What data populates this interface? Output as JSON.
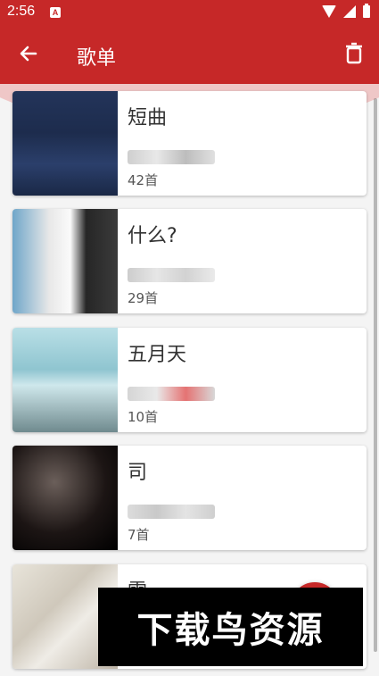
{
  "status_bar": {
    "time": "2:56"
  },
  "app_bar": {
    "title": "歌单"
  },
  "playlists": [
    {
      "name": "短曲",
      "count": "42首"
    },
    {
      "name": "什么?",
      "count": "29首"
    },
    {
      "name": "五月天",
      "count": "10首"
    },
    {
      "name": "司",
      "count": "7首"
    },
    {
      "name": "雷",
      "count": ""
    }
  ],
  "watermark": {
    "text": "下载鸟资源"
  },
  "colors": {
    "primary": "#c62828",
    "card": "#ffffff",
    "background": "#f4f4f4"
  }
}
